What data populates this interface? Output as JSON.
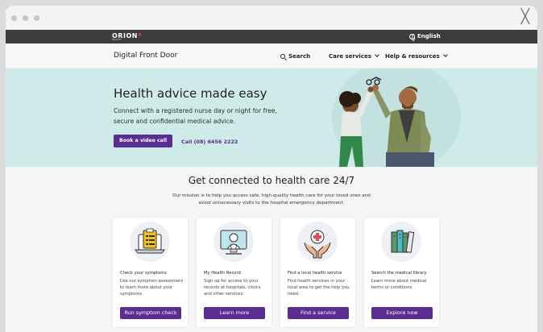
{
  "window": {
    "close_glyph": "╳"
  },
  "topbar": {
    "logo": "ORION",
    "logo_sub": "HEALTH",
    "language": "English"
  },
  "nav": {
    "site_title": "Digital Front Door",
    "search_label": "Search",
    "care_services_label": "Care services",
    "help_label": "Help & resources"
  },
  "hero": {
    "heading": "Health advice made easy",
    "body": "Connect with a registered nurse day or night for free, secure and confidential medical advice.",
    "video_button": "Book a video call",
    "call_link": "Call (08) 6456 2222"
  },
  "intro": {
    "heading": "Get connected to health care 24/7",
    "mission": "Our mission is to help you access safe, high-quality health care for your loved ones and avoid unnecessary visits to the hospital emergency department."
  },
  "cards": [
    {
      "title": "Check your symptoms",
      "desc": "Use our symptom assessment to learn more about your symptoms.",
      "button": "Run symptom check",
      "icon": "clipboard-laptop-icon"
    },
    {
      "title": "My Health Record",
      "desc": "Sign up for access to your records at hospitals, clinics and other services.",
      "button": "Learn more",
      "icon": "doctor-screen-icon"
    },
    {
      "title": "Find a local health service",
      "desc": "Find health services in your local area to get the help you need.",
      "button": "Find a service",
      "icon": "hands-medical-cross-icon"
    },
    {
      "title": "Search the medical library",
      "desc": "Learn more about medical terms or conditions.",
      "button": "Explore now",
      "icon": "books-icon"
    }
  ],
  "colors": {
    "brand_purple": "#5a2d91",
    "hero_bg": "#cfebe9",
    "topbar": "#3c3c3c"
  }
}
